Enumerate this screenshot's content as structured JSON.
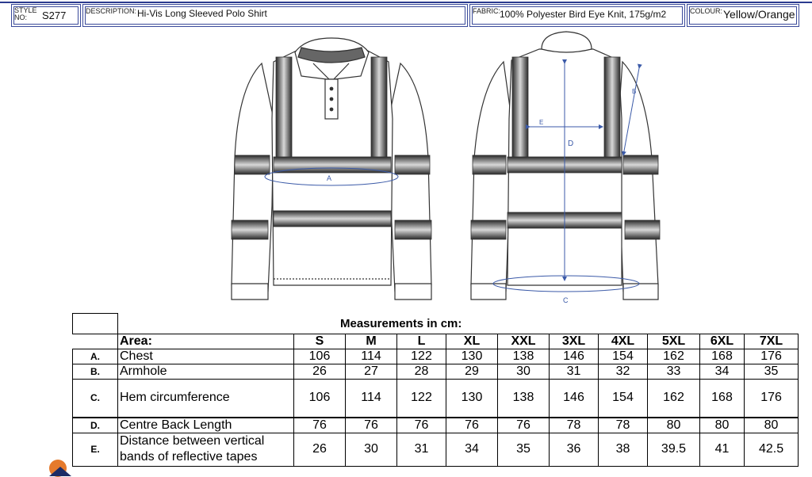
{
  "header": {
    "style_label": "STYLE NO:",
    "style_value": "S277",
    "description_label": "DESCRIPTION:",
    "description_value": "Hi-Vis Long Sleeved Polo Shirt",
    "fabric_label": "FABRIC:",
    "fabric_value": "100% Polyester Bird Eye Knit, 175g/m2",
    "colour_label": "COLOUR:",
    "colour_value": "Yellow/Orange"
  },
  "diagram": {
    "label_a": "A",
    "label_b": "B",
    "label_c": "C",
    "label_d": "D",
    "label_e": "E"
  },
  "table": {
    "title": "Measurements in cm:",
    "area_header": "Area:",
    "sizes": [
      "S",
      "M",
      "L",
      "XL",
      "XXL",
      "3XL",
      "4XL",
      "5XL",
      "6XL",
      "7XL"
    ],
    "rows": [
      {
        "code": "A.",
        "area": "Chest",
        "values": [
          "106",
          "114",
          "122",
          "130",
          "138",
          "146",
          "154",
          "162",
          "168",
          "176"
        ]
      },
      {
        "code": "B.",
        "area": "Armhole",
        "values": [
          "26",
          "27",
          "28",
          "29",
          "30",
          "31",
          "32",
          "33",
          "34",
          "35"
        ]
      },
      {
        "code": "C.",
        "area": "Hem circumference",
        "values": [
          "106",
          "114",
          "122",
          "130",
          "138",
          "146",
          "154",
          "162",
          "168",
          "176"
        ]
      },
      {
        "code": "D.",
        "area": "Centre Back Length",
        "values": [
          "76",
          "76",
          "76",
          "76",
          "76",
          "78",
          "78",
          "80",
          "80",
          "80"
        ]
      },
      {
        "code": "E.",
        "area": "Distance between vertical bands of reflective tapes",
        "values": [
          "26",
          "30",
          "31",
          "34",
          "35",
          "36",
          "38",
          "39.5",
          "41",
          "42.5"
        ]
      }
    ]
  },
  "colors": {
    "border_blue": "#2b3b8f",
    "arrow_blue": "#3b5aa8",
    "corner_orange": "#e57a2c"
  }
}
